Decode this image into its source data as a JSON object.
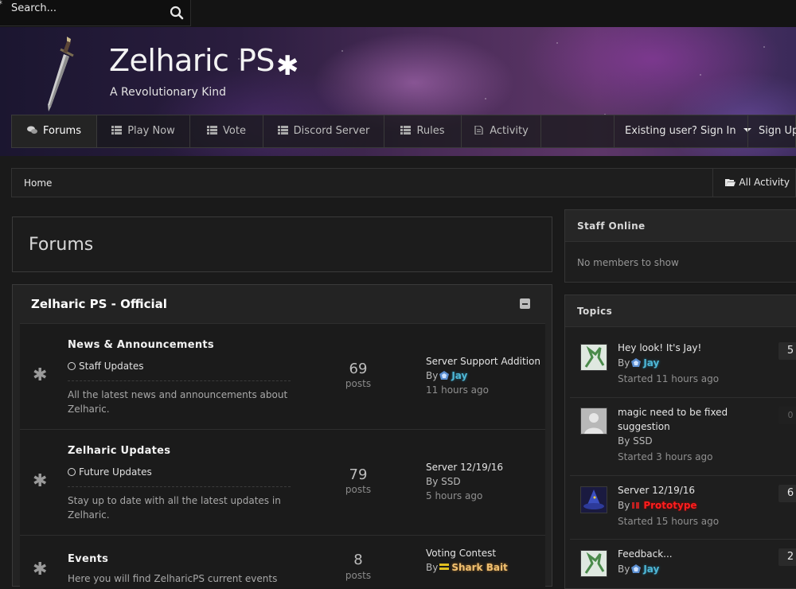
{
  "search": {
    "placeholder": "Search...",
    "star": "*"
  },
  "header": {
    "title": "Zelharic PS",
    "title_star": "✱",
    "tagline": "A Revolutionary Kind"
  },
  "nav": {
    "items": [
      {
        "label": "Forums",
        "icon": "comments-icon"
      },
      {
        "label": "Play Now",
        "icon": "list-icon"
      },
      {
        "label": "Vote",
        "icon": "list-icon"
      },
      {
        "label": "Discord Server",
        "icon": "list-icon"
      },
      {
        "label": "Rules",
        "icon": "list-icon"
      },
      {
        "label": "Activity",
        "icon": "document-icon"
      }
    ],
    "sign_in": "Existing user? Sign In",
    "sign_up": "Sign Up"
  },
  "breadcrumb": {
    "home": "Home",
    "all_activity": "All Activity"
  },
  "page_title": "Forums",
  "category": {
    "title": "Zelharic PS - Official",
    "forums": [
      {
        "icon": "✱",
        "name": "News & Announcements",
        "subforum": "Staff Updates",
        "description": "All the latest news and announcements about Zelharic.",
        "count": "69",
        "count_label": "posts",
        "last_title": "Server Support Addition",
        "by": "By",
        "last_user": "Jay",
        "last_time": "11 hours ago"
      },
      {
        "icon": "✱",
        "name": "Zelharic Updates",
        "subforum": "Future Updates",
        "description": "Stay up to date with all the latest updates in Zelharic.",
        "count": "79",
        "count_label": "posts",
        "last_title": "Server 12/19/16",
        "by": "By",
        "last_user": "SSD",
        "last_time": "5 hours ago"
      },
      {
        "icon": "✱",
        "name": "Events",
        "description": "Here you will find ZelharicPS current events",
        "count": "8",
        "count_label": "posts",
        "last_title": "Voting Contest",
        "by": "By",
        "last_user": "Shark Bait"
      }
    ]
  },
  "staff_online": {
    "title": "Staff Online",
    "empty": "No members to show"
  },
  "topics": {
    "title": "Topics",
    "items": [
      {
        "title": "Hey look! It's Jay!",
        "by": "By",
        "user": "Jay",
        "started": "Started 11 hours ago",
        "count": "5"
      },
      {
        "title": "magic need to be fixed suggestion",
        "by": "By",
        "user": "SSD",
        "started": "Started 3 hours ago",
        "count": "0"
      },
      {
        "title": "Server 12/19/16",
        "by": "By",
        "user": "Prototype",
        "started": "Started 15 hours ago",
        "count": "6"
      },
      {
        "title": "Feedback...",
        "by": "By",
        "user": "Jay",
        "count": "2"
      }
    ]
  },
  "colors": {
    "accent_jay": "#4fb7d6",
    "accent_shark": "#f0c070",
    "accent_prototype": "#ff1e1e"
  }
}
